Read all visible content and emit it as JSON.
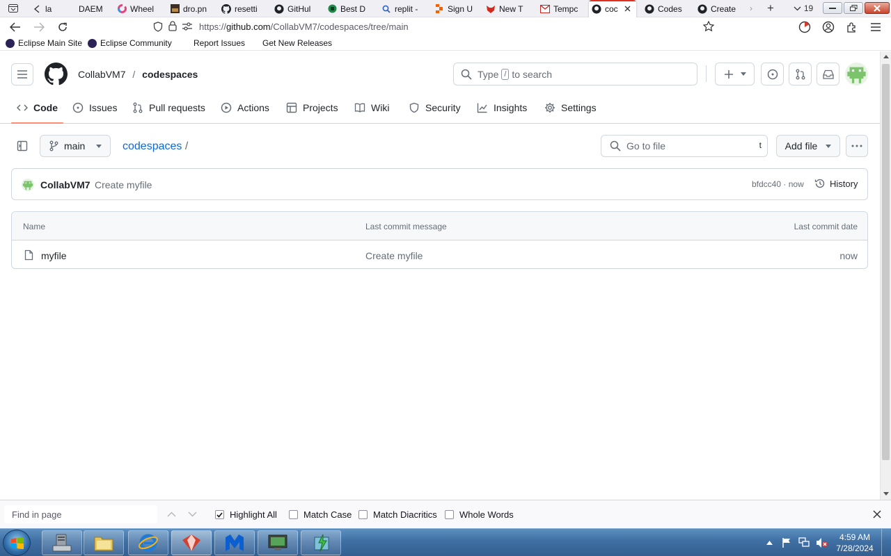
{
  "browser": {
    "tabs": [
      {
        "label": "la",
        "icon": "back-arrow-icon"
      },
      {
        "label": "DAEM",
        "icon": "page-icon"
      },
      {
        "label": "Wheel",
        "icon": "colorful-c-icon"
      },
      {
        "label": "dro.pn",
        "icon": "image-icon"
      },
      {
        "label": "resetti",
        "icon": "github-icon"
      },
      {
        "label": "GitHul",
        "icon": "github-icon"
      },
      {
        "label": "Best D",
        "icon": "green-circle-icon"
      },
      {
        "label": "replit -",
        "icon": "search-icon"
      },
      {
        "label": "Sign U",
        "icon": "replit-icon"
      },
      {
        "label": "New T",
        "icon": "fox-icon"
      },
      {
        "label": "Tempc",
        "icon": "mail-icon"
      },
      {
        "label": "coc",
        "icon": "github-icon"
      },
      {
        "label": "Codes",
        "icon": "github-icon"
      },
      {
        "label": "Create",
        "icon": "github-icon"
      }
    ],
    "tab_count": "19",
    "url_prefix": "https://",
    "url_host": "github.com",
    "url_path": "/CollabVM7/codespaces/tree/main",
    "bookmarks": [
      "Eclipse Main Site",
      "Eclipse Community",
      "Report Issues",
      "Get New Releases"
    ]
  },
  "github": {
    "owner": "CollabVM7",
    "separator": "/",
    "repo": "codespaces",
    "search_placeholder_pre": "Type",
    "search_key": "/",
    "search_placeholder_post": "to search",
    "tabs": [
      "Code",
      "Issues",
      "Pull requests",
      "Actions",
      "Projects",
      "Wiki",
      "Security",
      "Insights",
      "Settings"
    ],
    "branch": "main",
    "breadcrumb_repo": "codespaces",
    "breadcrumb_sep": "/",
    "go_to_file": "Go to file",
    "go_to_file_key": "t",
    "add_file": "Add file",
    "commit": {
      "author": "CollabVM7",
      "message": "Create myfile",
      "sha": "bfdcc40",
      "dot": "·",
      "time": "now",
      "history": "History"
    },
    "table": {
      "headers": [
        "Name",
        "Last commit message",
        "Last commit date"
      ],
      "rows": [
        {
          "name": "myfile",
          "message": "Create myfile",
          "date": "now"
        }
      ]
    }
  },
  "findbar": {
    "placeholder": "Find in page",
    "options": [
      {
        "label": "Highlight All",
        "checked": true
      },
      {
        "label": "Match Case",
        "checked": false
      },
      {
        "label": "Match Diacritics",
        "checked": false
      },
      {
        "label": "Whole Words",
        "checked": false
      }
    ]
  },
  "taskbar": {
    "time": "4:59 AM",
    "date": "7/28/2024"
  },
  "colors": {
    "accent_link": "#0969da",
    "tab_underline": "#fd8c73",
    "avatar_green": "#7bc46b"
  }
}
